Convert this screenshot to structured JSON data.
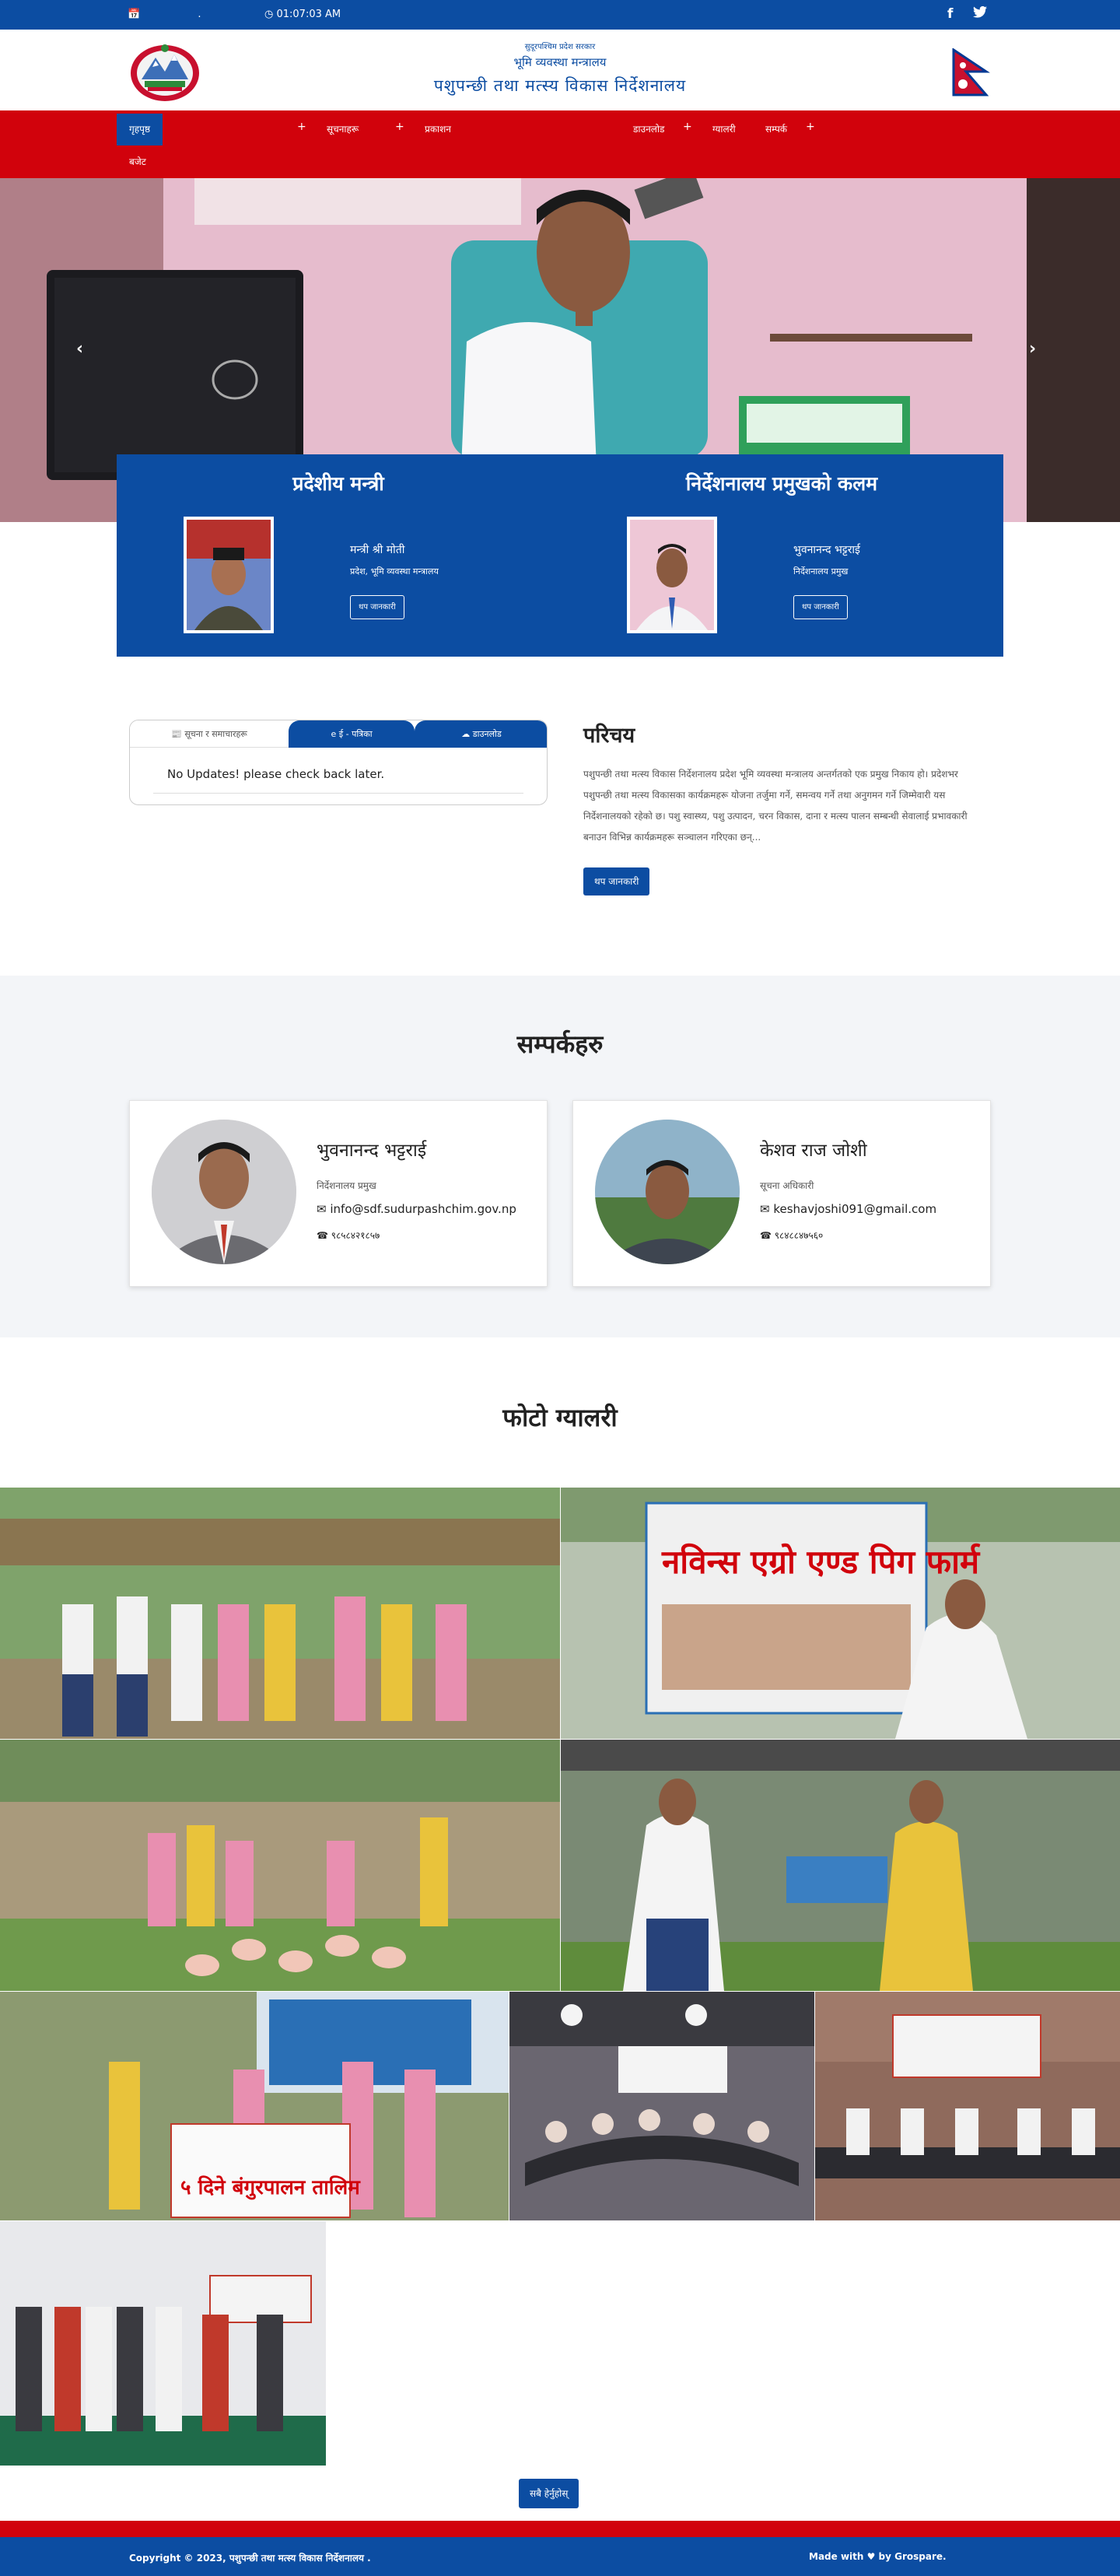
{
  "topbar": {
    "date": ".",
    "time": "01:07:03 AM"
  },
  "header": {
    "line1": "सुदूरपश्चिम प्रदेश सरकार",
    "line2": "भूमि व्यवस्था मन्त्रालय",
    "line3": "पशुपन्छी तथा मत्स्य विकास निर्देशनालय"
  },
  "nav": {
    "items": [
      {
        "label": "गृहपृष्ठ"
      },
      {
        "label": "सूचनाहरू"
      },
      {
        "label": "प्रकाशन"
      },
      {
        "label": "डाउनलोड"
      },
      {
        "label": "ग्यालरी"
      },
      {
        "label": "सम्पर्क"
      },
      {
        "label": "बजेट"
      }
    ]
  },
  "officials": {
    "left_title": "प्रदेशीय मन्त्री",
    "left_name": "मन्त्री श्री मोती",
    "left_role": "प्रदेश, भूमि व्यवस्था मन्त्रालय",
    "left_btn": "थप जानकारी",
    "right_title": "निर्देशनालय प्रमुखको कलम",
    "right_name": "भुवनानन्द भट्टराई",
    "right_role": "निर्देशनालय प्रमुख",
    "right_btn": "थप जानकारी"
  },
  "tabs": {
    "tab1": "सूचना र समाचारहरू",
    "tab2": "ई - पत्रिका",
    "tab3": "डाउनलोड",
    "empty_msg": "No Updates! please check back later."
  },
  "intro": {
    "title": "परिचय",
    "text": "पशुपन्छी तथा मत्स्य विकास निर्देशनालय प्रदेश भूमि व्यवस्था मन्त्रालय अन्तर्गतको एक प्रमुख निकाय हो। प्रदेशभर पशुपन्छी तथा मत्स्य विकासका कार्यक्रमहरू योजना तर्जुमा गर्ने, समन्वय गर्ने तथा अनुगमन गर्ने जिम्मेवारी यस निर्देशनालयको रहेको छ। पशु स्वास्थ्य, पशु उत्पादन, चरन विकास, दाना र मत्स्य पालन सम्बन्धी सेवालाई प्रभावकारी बनाउन विभिन्न कार्यक्रमहरू सञ्चालन गरिएका छन्...",
    "btn": "थप जानकारी"
  },
  "contacts": {
    "title": "सम्पर्कहरु",
    "people": [
      {
        "name": "भुवनानन्द भट्टराई",
        "role": "निर्देशनालय प्रमुख",
        "email": "info@sdf.sudurpashchim.gov.np",
        "phone": "९८५८४२१८५७"
      },
      {
        "name": "केशव राज जोशी",
        "role": "सूचना अधिकारी",
        "email": "keshavjoshi091@gmail.com",
        "phone": "९८४८८४७५६०"
      }
    ]
  },
  "gallery": {
    "title": "फोटो ग्यालरी",
    "btn": "सबै हेर्नुहोस्",
    "banner_pig": "नविन्स एग्रो एण्ड पिग फार्म",
    "banner_training": "५ दिने बंगुरपालन तालिम"
  },
  "footer": {
    "copyright": "Copyright © 2023, पशुपन्छी तथा मत्स्य विकास निर्देशनालय .",
    "made_with": "Made with ♥ by Grospare."
  },
  "colors": {
    "primary_blue": "#0c4da2",
    "nav_red": "#d1020c"
  },
  "icons": [
    "calendar-icon",
    "clock-icon",
    "facebook-icon",
    "twitter-icon",
    "newspaper-icon",
    "internet-explorer-icon",
    "cloud-download-icon",
    "envelope-icon",
    "phone-icon",
    "heart-icon"
  ]
}
